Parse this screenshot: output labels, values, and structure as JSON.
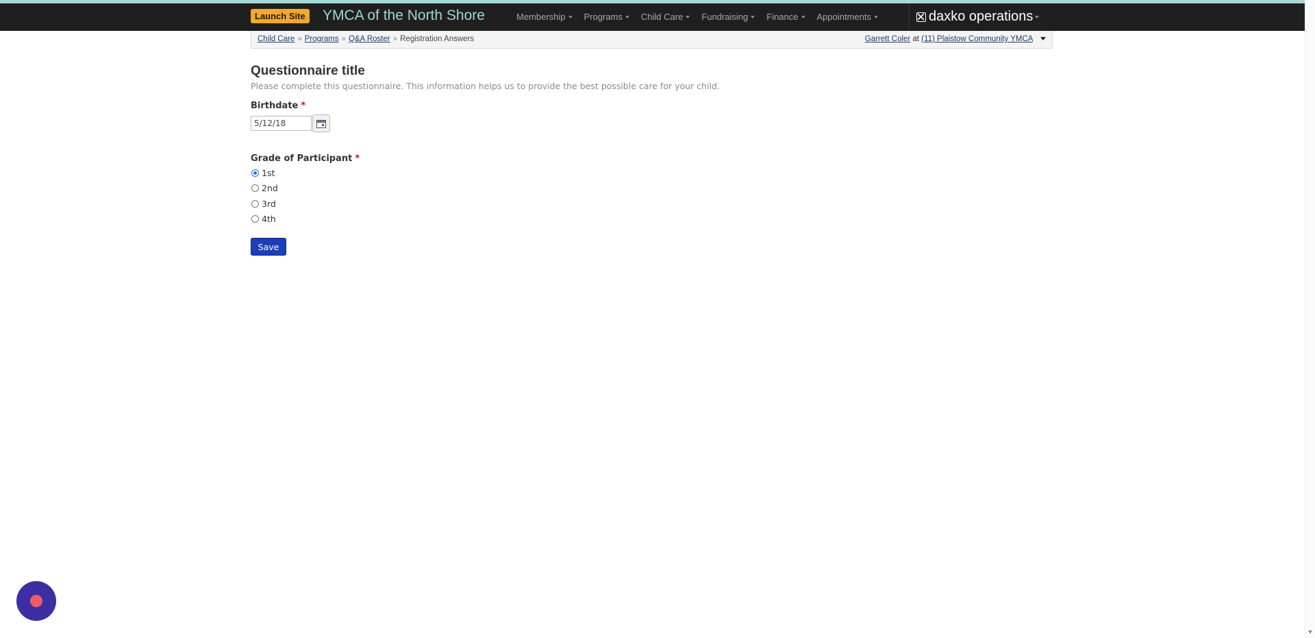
{
  "header": {
    "launch_label": "Launch Site",
    "brand": "YMCA of the North Shore",
    "menu": [
      {
        "label": "Membership"
      },
      {
        "label": "Programs"
      },
      {
        "label": "Child Care"
      },
      {
        "label": "Fundraising"
      },
      {
        "label": "Finance"
      },
      {
        "label": "Appointments"
      }
    ],
    "product": "daxko operations",
    "product_icon": "daxko-logo-icon"
  },
  "breadcrumb": {
    "items": [
      "Child Care",
      "Programs",
      "Q&A Roster"
    ],
    "separator": "»",
    "current": "Registration Answers"
  },
  "user": {
    "name": "Garrett Coler",
    "at": "at",
    "location": "(11) Plaistow Community YMCA"
  },
  "form": {
    "title": "Questionnaire title",
    "subtitle": "Please complete this questionnaire. This information helps us to provide the best possible care for your child.",
    "birthdate": {
      "label": "Birthdate",
      "required_mark": "*",
      "value": "5/12/18",
      "icon": "calendar-icon"
    },
    "grade": {
      "label": "Grade of Participant",
      "required_mark": "*",
      "options": [
        "1st",
        "2nd",
        "3rd",
        "4th"
      ],
      "selected": "1st"
    },
    "save_label": "Save"
  },
  "colors": {
    "navbar": "#1f1f1f",
    "brand": "#9fd8d2",
    "launch": "#f0a92a",
    "save": "#1d3fb5",
    "chat": "#3b2fa3"
  }
}
